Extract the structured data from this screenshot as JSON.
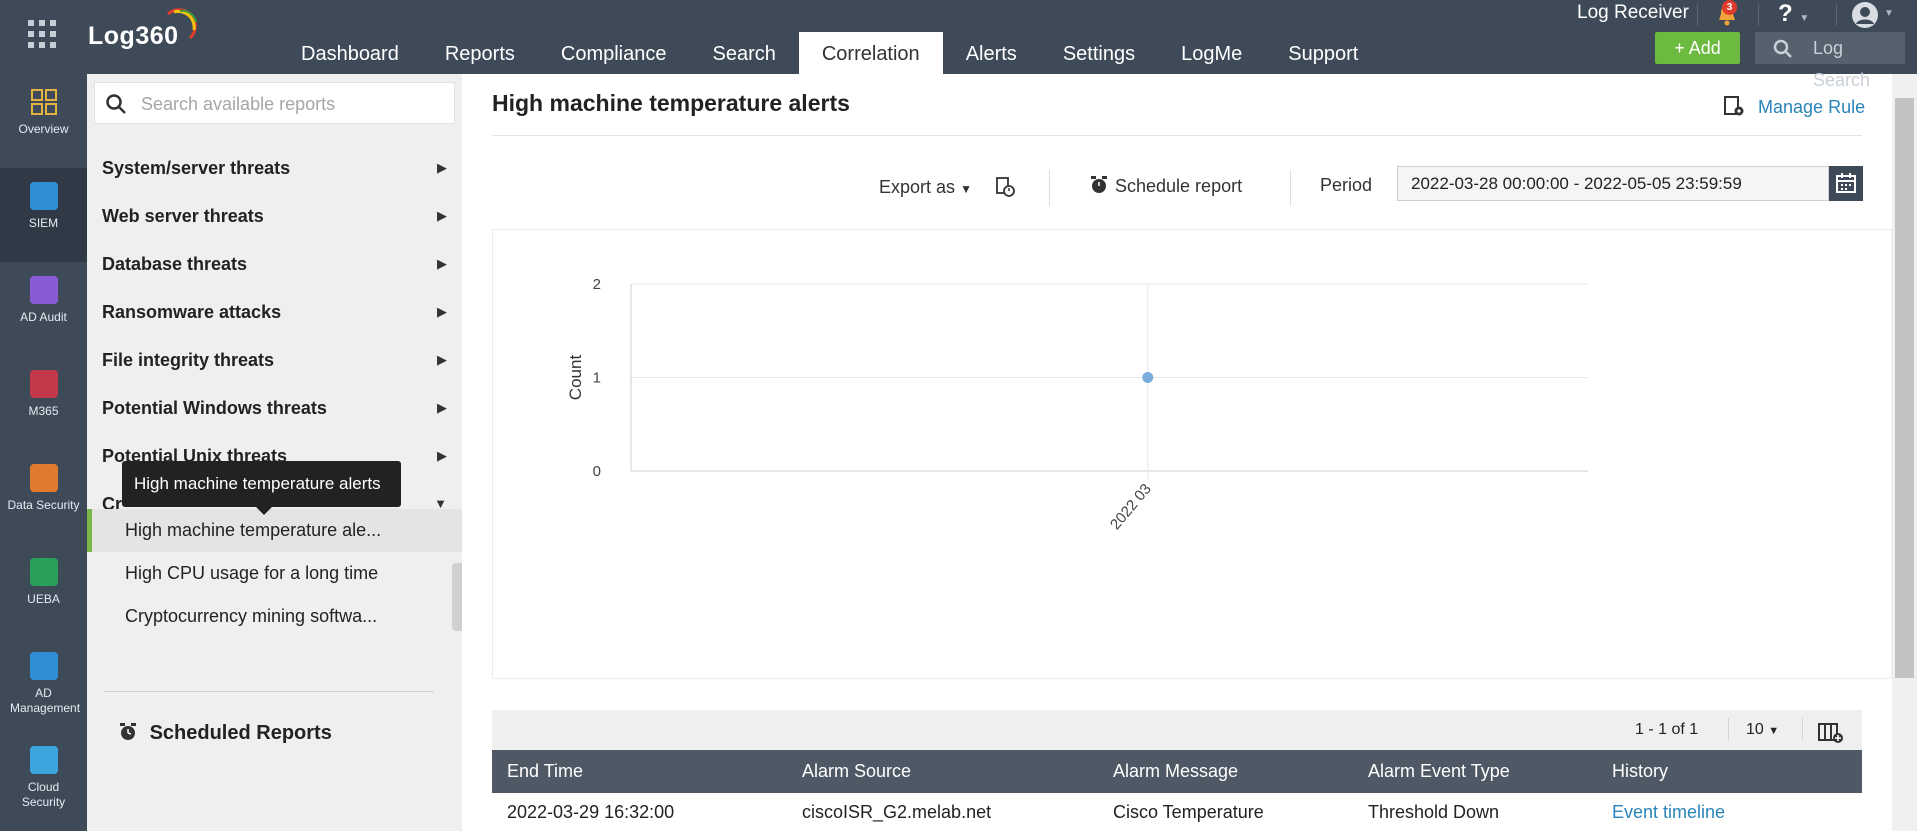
{
  "header": {
    "logo": "Log360",
    "nav": [
      "Dashboard",
      "Reports",
      "Compliance",
      "Search",
      "Correlation",
      "Alerts",
      "Settings",
      "LogMe",
      "Support"
    ],
    "active_nav": "Correlation",
    "log_receiver": "Log Receiver",
    "notification_count": "3",
    "help": "?",
    "add_label": "+ Add",
    "log_search_label": "Log Search"
  },
  "rail": {
    "items": [
      "Overview",
      "SIEM",
      "AD Audit",
      "M365",
      "Data Security",
      "UEBA",
      "AD Management",
      "Cloud Security"
    ],
    "active": "SIEM"
  },
  "sidebar": {
    "search_placeholder": "Search available reports",
    "categories": [
      "System/server threats",
      "Web server threats",
      "Database threats",
      "Ransomware attacks",
      "File integrity threats",
      "Potential Windows threats",
      "Potential Unix threats",
      "Cr"
    ],
    "subitems": [
      "High machine temperature ale...",
      "High CPU usage for a long time",
      "Cryptocurrency mining softwa..."
    ],
    "tooltip": "High machine temperature alerts",
    "scheduled_reports": "Scheduled Reports"
  },
  "main": {
    "title": "High machine temperature alerts",
    "manage_rule": "Manage Rule",
    "export_as": "Export as",
    "schedule_report": "Schedule report",
    "period_label": "Period",
    "period_value": "2022-03-28 00:00:00 - 2022-05-05 23:59:59"
  },
  "chart_data": {
    "type": "scatter",
    "x": [
      "2022 03"
    ],
    "values": [
      1
    ],
    "ylabel": "Count",
    "xlabel": "",
    "ylim": [
      0,
      2
    ],
    "yticks": [
      0,
      1,
      2
    ],
    "grid": true,
    "colors": {
      "point": "#7aacdc",
      "grid": "#e6e6e6",
      "axis": "#cfcfcf"
    }
  },
  "table": {
    "pager": "1 - 1 of 1",
    "per_page": "10",
    "columns": [
      "End Time",
      "Alarm Source",
      "Alarm Message",
      "Alarm Event Type",
      "History"
    ],
    "rows": [
      [
        "2022-03-29 16:32:00",
        "ciscoISR_G2.melab.net",
        "Cisco Temperature",
        "Threshold Down",
        "Event timeline"
      ]
    ]
  },
  "colors": {
    "topbar": "#3e4a58",
    "add_button": "#6cba3f",
    "link": "#2a84b9",
    "selected_accent": "#7ab648"
  }
}
